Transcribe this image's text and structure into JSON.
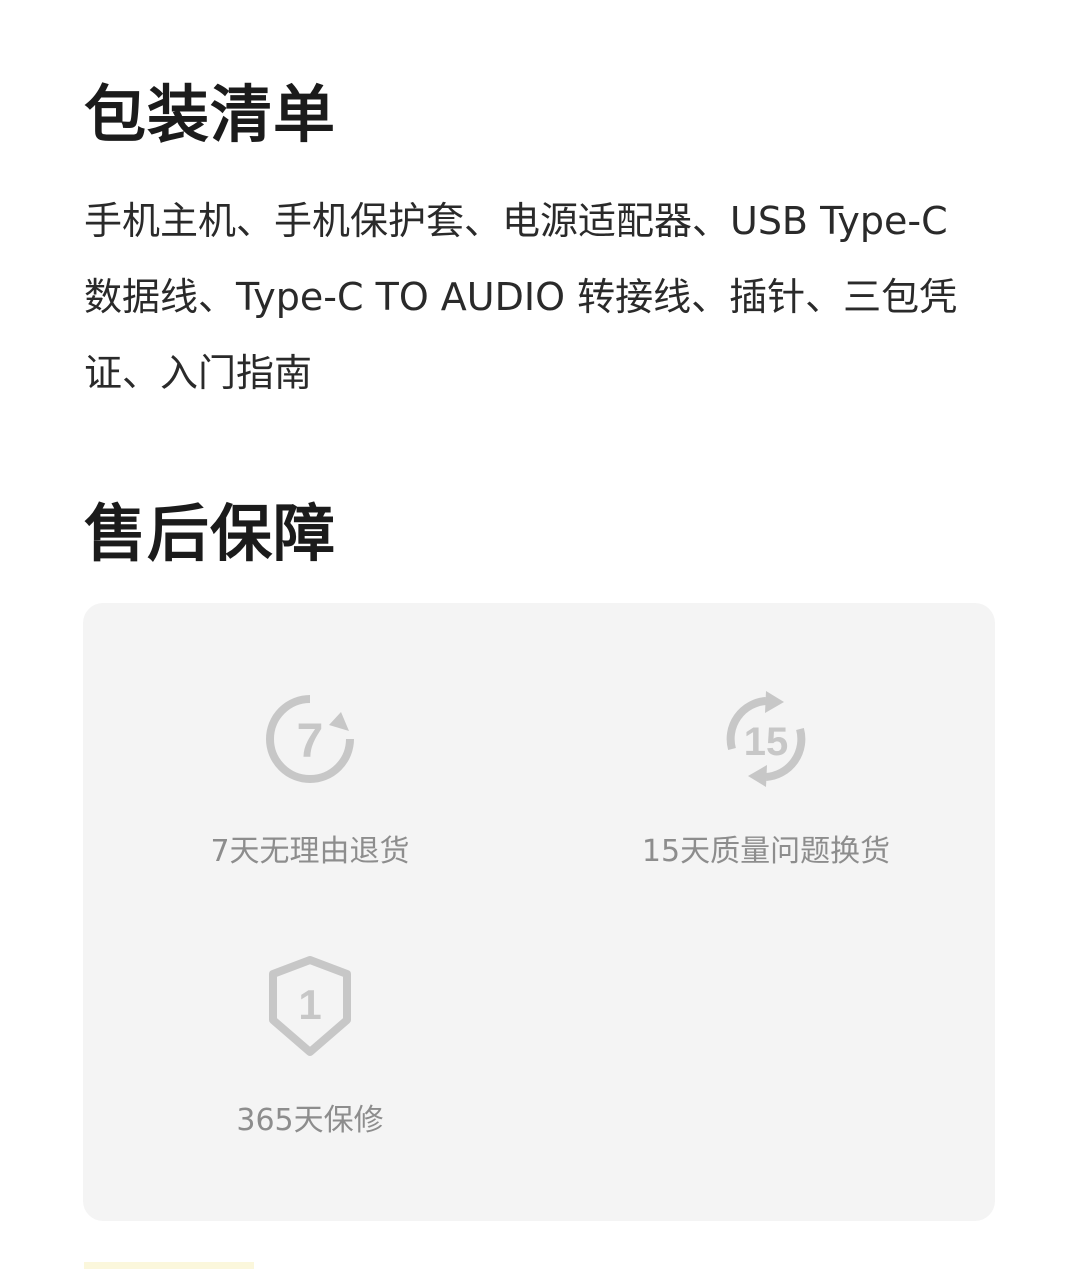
{
  "package": {
    "title": "包装清单",
    "content": "手机主机、手机保护套、电源适配器、USB Type-C 数据线、Type-C TO AUDIO 转接线、插针、三包凭证、入门指南"
  },
  "after_sales": {
    "title": "售后保障",
    "items": [
      {
        "icon": "seven-day-return-icon",
        "icon_text": "7",
        "label": "7天无理由退货"
      },
      {
        "icon": "fifteen-day-exchange-icon",
        "icon_text": "15",
        "label": "15天质量问题换货"
      },
      {
        "icon": "warranty-shield-icon",
        "icon_text": "1",
        "label": "365天保修"
      }
    ]
  },
  "colors": {
    "title": "#1b1b1b",
    "body_text": "#2a2a2a",
    "card_background": "#f4f4f4",
    "muted_text": "#8d8d8d",
    "icon": "#c7c7c7"
  }
}
